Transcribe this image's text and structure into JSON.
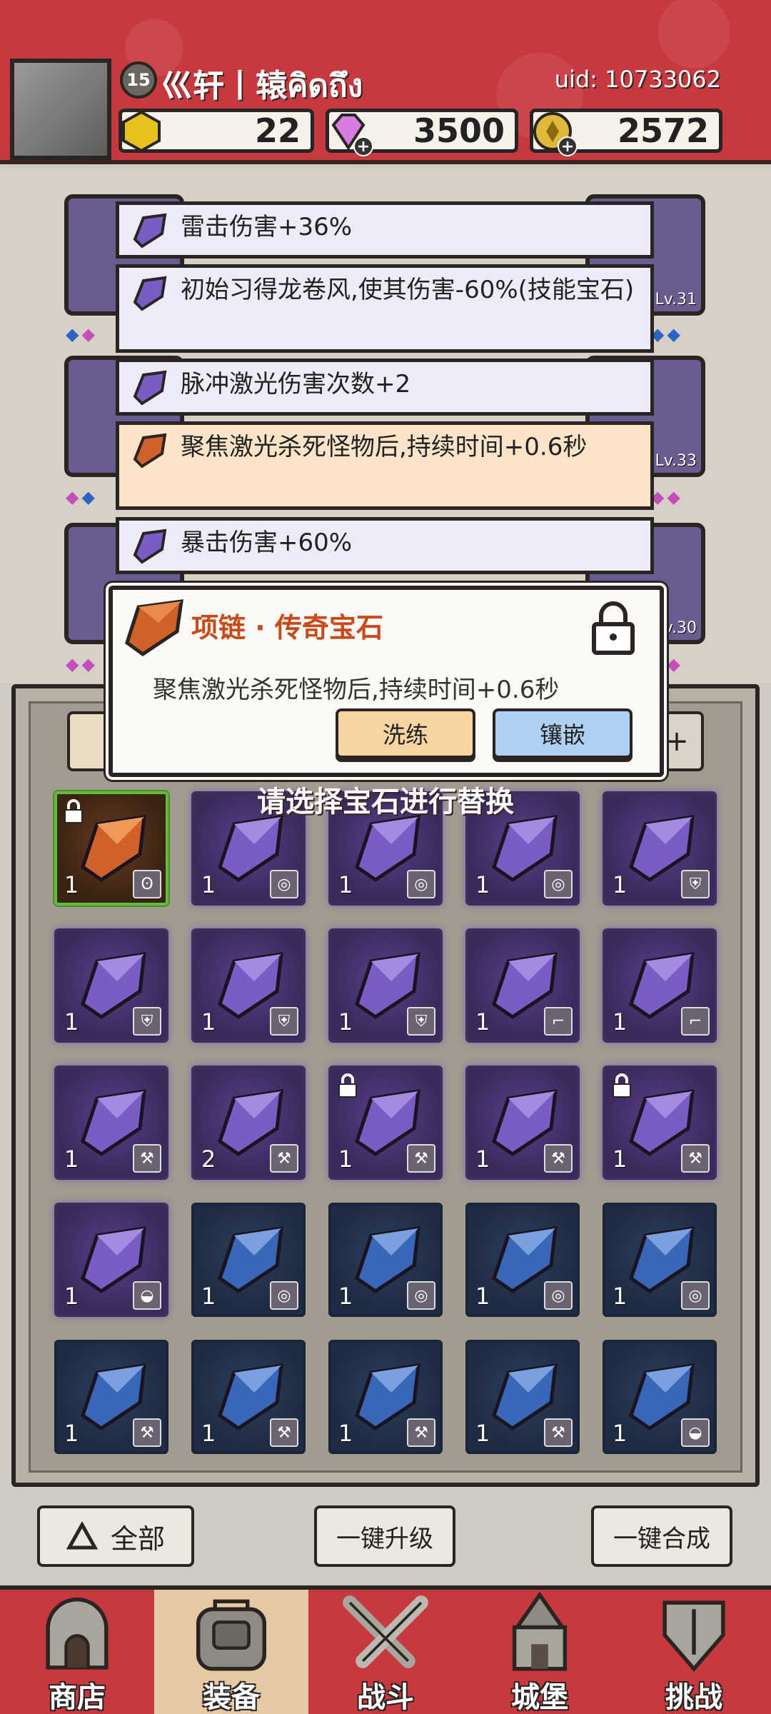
{
  "header": {
    "level": "15",
    "player_name": "巛轩丨辕คิดถึง",
    "uid": "uid: 10733062",
    "currencies": {
      "gold": "22",
      "gems": "3500",
      "coins": "2572"
    }
  },
  "equipment": {
    "levels": {
      "right_top": "Lv.31",
      "right_mid": "Lv.33",
      "right_bottom": "Lv.30"
    }
  },
  "affixes": [
    {
      "text": "雷击伤害+36%",
      "rarity": "purple"
    },
    {
      "text": "初始习得龙卷风,使其伤害-60%(技能宝石)",
      "rarity": "purple"
    },
    {
      "text": "脉冲激光伤害次数+2",
      "rarity": "purple"
    },
    {
      "text": "聚焦激光杀死怪物后,持续时间+0.6秒",
      "rarity": "orange"
    },
    {
      "text": "暴击伤害+60%",
      "rarity": "purple"
    }
  ],
  "popup": {
    "title": "项链 · 传奇宝石",
    "description": "聚焦激光杀死怪物后,持续时间+0.6秒",
    "refine_label": "洗练",
    "inlay_label": "镶嵌"
  },
  "inventory": {
    "hint": "请选择宝石进行替换",
    "gems": [
      {
        "color": "orange",
        "count": "1",
        "slot": "necklace",
        "locked": true,
        "selected": true
      },
      {
        "color": "purple",
        "count": "1",
        "slot": "ring",
        "locked": false
      },
      {
        "color": "purple",
        "count": "1",
        "slot": "ring",
        "locked": false
      },
      {
        "color": "purple",
        "count": "1",
        "slot": "ring",
        "locked": false
      },
      {
        "color": "purple",
        "count": "1",
        "slot": "armor",
        "locked": false
      },
      {
        "color": "purple",
        "count": "1",
        "slot": "armor",
        "locked": false
      },
      {
        "color": "purple",
        "count": "1",
        "slot": "armor",
        "locked": false
      },
      {
        "color": "purple",
        "count": "1",
        "slot": "armor",
        "locked": false
      },
      {
        "color": "purple",
        "count": "1",
        "slot": "boots",
        "locked": false
      },
      {
        "color": "purple",
        "count": "1",
        "slot": "boots",
        "locked": false
      },
      {
        "color": "purple",
        "count": "1",
        "slot": "weapon",
        "locked": false
      },
      {
        "color": "purple",
        "count": "2",
        "slot": "weapon",
        "locked": false
      },
      {
        "color": "purple",
        "count": "1",
        "slot": "weapon",
        "locked": true
      },
      {
        "color": "purple",
        "count": "1",
        "slot": "weapon",
        "locked": false
      },
      {
        "color": "purple",
        "count": "1",
        "slot": "weapon",
        "locked": true
      },
      {
        "color": "purple",
        "count": "1",
        "slot": "helmet",
        "locked": false
      },
      {
        "color": "blue",
        "count": "1",
        "slot": "ring",
        "locked": false
      },
      {
        "color": "blue",
        "count": "1",
        "slot": "ring",
        "locked": false
      },
      {
        "color": "blue",
        "count": "1",
        "slot": "ring",
        "locked": false
      },
      {
        "color": "blue",
        "count": "1",
        "slot": "ring",
        "locked": false
      },
      {
        "color": "blue",
        "count": "1",
        "slot": "weapon",
        "locked": false
      },
      {
        "color": "blue",
        "count": "1",
        "slot": "weapon",
        "locked": false
      },
      {
        "color": "blue",
        "count": "1",
        "slot": "weapon",
        "locked": false
      },
      {
        "color": "blue",
        "count": "1",
        "slot": "weapon",
        "locked": false
      },
      {
        "color": "blue",
        "count": "1",
        "slot": "helmet",
        "locked": false
      }
    ]
  },
  "actions": {
    "filter_label": "全部",
    "upgrade_label": "一键升级",
    "merge_label": "一键合成"
  },
  "nav": [
    {
      "label": "商店",
      "icon": "shop-icon",
      "active": false
    },
    {
      "label": "装备",
      "icon": "bag-icon",
      "active": true
    },
    {
      "label": "战斗",
      "icon": "swords-icon",
      "active": false
    },
    {
      "label": "城堡",
      "icon": "castle-icon",
      "active": false
    },
    {
      "label": "挑战",
      "icon": "challenge-icon",
      "active": false
    }
  ],
  "colors": {
    "header_red": "#c8383f",
    "purple_gem": "#6b4aa8",
    "blue_gem": "#3a66b8",
    "orange_gem": "#d0612a",
    "popup_title": "#c84a1a"
  }
}
